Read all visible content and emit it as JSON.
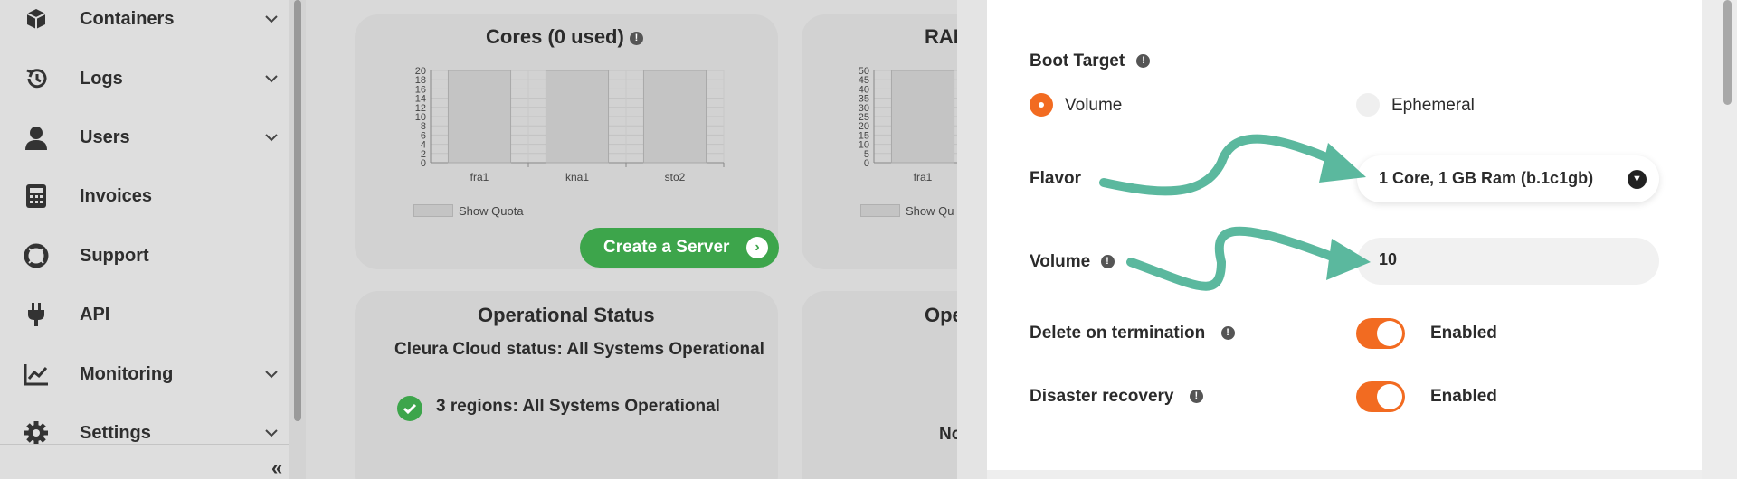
{
  "sidebar": {
    "items": [
      {
        "label": "Containers",
        "icon": "box-icon",
        "has_submenu": true
      },
      {
        "label": "Logs",
        "icon": "history-icon",
        "has_submenu": true
      },
      {
        "label": "Users",
        "icon": "user-icon",
        "has_submenu": true
      },
      {
        "label": "Invoices",
        "icon": "calculator-icon",
        "has_submenu": false
      },
      {
        "label": "Support",
        "icon": "lifebuoy-icon",
        "has_submenu": false
      },
      {
        "label": "API",
        "icon": "plug-icon",
        "has_submenu": false
      },
      {
        "label": "Monitoring",
        "icon": "chart-line-icon",
        "has_submenu": true
      },
      {
        "label": "Settings",
        "icon": "gear-icon",
        "has_submenu": true
      }
    ],
    "collapse_label": "«"
  },
  "cards": {
    "cores": {
      "title": "Cores (0 used)",
      "legend": "Show Quota",
      "create_button": "Create a Server",
      "chart_data": {
        "type": "bar",
        "title": "Cores (0 used)",
        "categories": [
          "fra1",
          "kna1",
          "sto2"
        ],
        "values": [
          20,
          20,
          20
        ],
        "ylim": [
          0,
          20
        ],
        "yticks": [
          0,
          2,
          4,
          6,
          8,
          10,
          12,
          14,
          16,
          18,
          20
        ],
        "legend": [
          "Show Quota"
        ],
        "grid": true
      }
    },
    "ram": {
      "title": "RAM",
      "legend": "Show Qu",
      "chart_data": {
        "type": "bar",
        "categories": [
          "fra1"
        ],
        "values": [
          50
        ],
        "ylim": [
          0,
          50
        ],
        "yticks": [
          0,
          5,
          10,
          15,
          20,
          25,
          30,
          35,
          40,
          45,
          50
        ],
        "legend": [
          "Show Qu"
        ],
        "grid": true
      }
    },
    "status": {
      "title": "Operational Status",
      "subtitle": "Cleura Cloud status: All Systems Operational",
      "regions": "3 regions: All Systems Operational"
    },
    "status2": {
      "title": "Ope",
      "text": "No"
    }
  },
  "form": {
    "boot_target": {
      "label": "Boot Target",
      "options": [
        "Volume",
        "Ephemeral"
      ],
      "selected": "Volume"
    },
    "flavor": {
      "label": "Flavor",
      "value": "1 Core, 1 GB Ram (b.1c1gb)"
    },
    "volume": {
      "label": "Volume",
      "value": "10"
    },
    "delete_on_termination": {
      "label": "Delete on termination",
      "state": "Enabled",
      "on": true
    },
    "disaster_recovery": {
      "label": "Disaster recovery",
      "state": "Enabled",
      "on": true
    }
  },
  "colors": {
    "accent": "#f26b21",
    "success": "#3da54b",
    "annotation_arrow": "#5bb89e"
  }
}
